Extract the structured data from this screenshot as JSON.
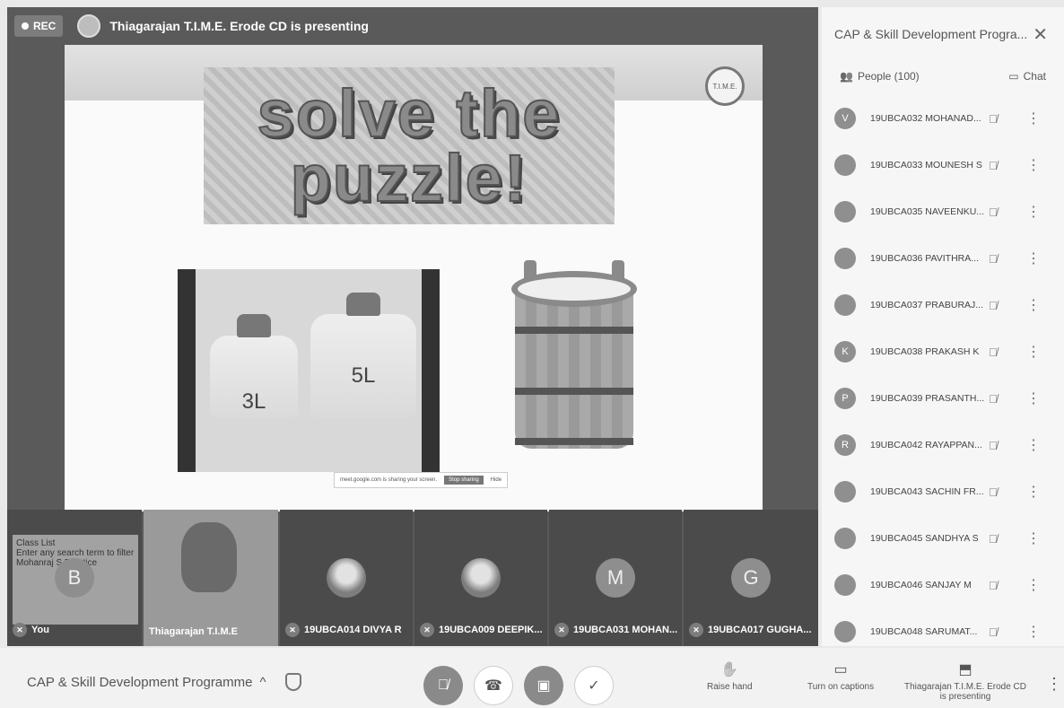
{
  "topbar": {
    "rec_label": "REC",
    "presenting_text": "Thiagarajan T.I.M.E. Erode CD is presenting"
  },
  "slide": {
    "title_line1": "solve the",
    "title_line2": "puzzle!",
    "logo_text": "T.I.M.E.",
    "jug_small_label": "3L",
    "jug_large_label": "5L",
    "share_notice": "meet.google.com is sharing your screen.",
    "stop_sharing_label": "Stop sharing",
    "hide_label": "Hide"
  },
  "tiles": [
    {
      "name": "You",
      "avatar": "B"
    },
    {
      "name": "Thiagarajan T.I.M.E",
      "avatar": ""
    },
    {
      "name": "19UBCA014 DIVYA R",
      "avatar": ""
    },
    {
      "name": "19UBCA009 DEEPIK...",
      "avatar": ""
    },
    {
      "name": "19UBCA031 MOHAN...",
      "avatar": "M"
    },
    {
      "name": "19UBCA017 GUGHA...",
      "avatar": "G"
    }
  ],
  "classlist": {
    "title": "Class List",
    "line1": "Enter any search term to filter",
    "line2": "Mohanraj S Practice"
  },
  "panel": {
    "title": "CAP & Skill Development Progra...",
    "people_tab": "People (100)",
    "chat_tab": "Chat",
    "participants": [
      {
        "avatar": "V",
        "name": "19UBCA032 MOHANAD..."
      },
      {
        "avatar": "",
        "name": "19UBCA033 MOUNESH S"
      },
      {
        "avatar": "",
        "name": "19UBCA035 NAVEENKU..."
      },
      {
        "avatar": "",
        "name": "19UBCA036 PAVITHRA..."
      },
      {
        "avatar": "",
        "name": "19UBCA037 PRABURAJ..."
      },
      {
        "avatar": "K",
        "name": "19UBCA038 PRAKASH K"
      },
      {
        "avatar": "P",
        "name": "19UBCA039 PRASANTH..."
      },
      {
        "avatar": "R",
        "name": "19UBCA042 RAYAPPAN..."
      },
      {
        "avatar": "",
        "name": "19UBCA043 SACHIN FR..."
      },
      {
        "avatar": "",
        "name": "19UBCA045 SANDHYA S"
      },
      {
        "avatar": "",
        "name": "19UBCA046 SANJAY M"
      },
      {
        "avatar": "",
        "name": "19UBCA048 SARUMAT..."
      }
    ]
  },
  "bottombar": {
    "meeting_name": "CAP & Skill Development Programme",
    "raise_hand": "Raise hand",
    "captions": "Turn on captions",
    "presenting_line1": "Thiagarajan T.I.M.E. Erode CD",
    "presenting_line2": "is presenting"
  }
}
